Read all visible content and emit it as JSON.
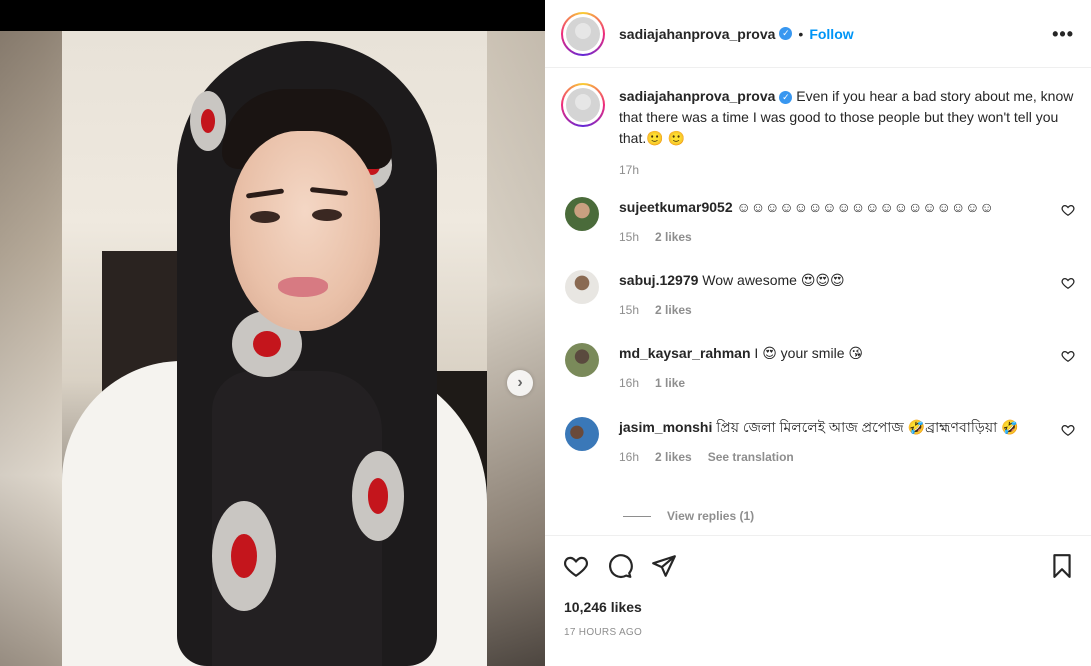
{
  "post": {
    "username": "sadiajahanprova_prova",
    "separator": "•",
    "follow_label": "Follow",
    "more_label": "•••",
    "next_label": "›",
    "carousel_count": 2,
    "carousel_index": 1
  },
  "caption": {
    "username": "sadiajahanprova_prova",
    "text": "Even if you hear a bad story about me, know that there was a time I was good to those people but they won't tell you that.🙂 🙂",
    "time": "17h"
  },
  "comments": [
    {
      "username": "sujeetkumar9052",
      "text": "☺☺☺☺☺☺☺☺☺☺☺☺☺☺☺☺☺☺",
      "time": "15h",
      "likes": "2 likes",
      "avatar_color": "#4a6b3a"
    },
    {
      "username": "sabuj.12979",
      "text": "Wow awesome 😍😍😍",
      "time": "15h",
      "likes": "2 likes",
      "avatar_color": "#6e6a62"
    },
    {
      "username": "md_kaysar_rahman",
      "text": "I 😍 your smile 😘",
      "time": "16h",
      "likes": "1 like",
      "avatar_color": "#7a8a5a"
    },
    {
      "username": "jasim_monshi",
      "text": "প্রিয় জেলা মিললেই আজ প্রপোজ 🤣ব্রাহ্মণবাড়িয়া 🤣",
      "time": "16h",
      "likes": "2 likes",
      "translation": "See translation",
      "avatar_color": "#3a78b8"
    }
  ],
  "view_replies": "View replies (1)",
  "actions": {
    "likes": "10,246 likes",
    "timestamp": "17 HOURS AGO"
  },
  "colors": {
    "accent": "#0095f6",
    "verified": "#3897f0",
    "muted": "#8e8e8e",
    "text": "#262626"
  }
}
